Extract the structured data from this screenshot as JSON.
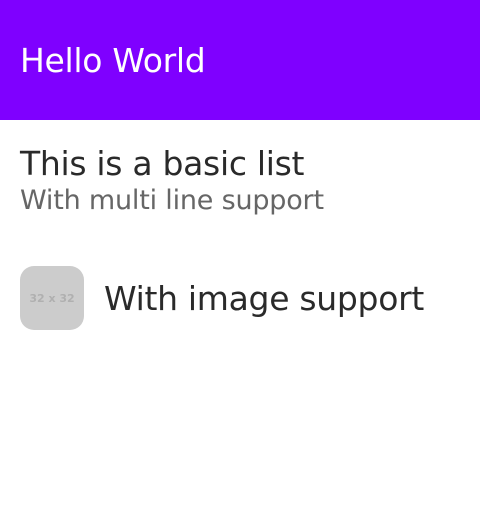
{
  "header": {
    "title": "Hello World",
    "background": "#7f00ff"
  },
  "list": {
    "basic_item": {
      "primary": "This is a basic list",
      "secondary": "With multi line support"
    },
    "image_item": {
      "thumbnail_text": "32 x 32",
      "label": "With image support"
    }
  }
}
